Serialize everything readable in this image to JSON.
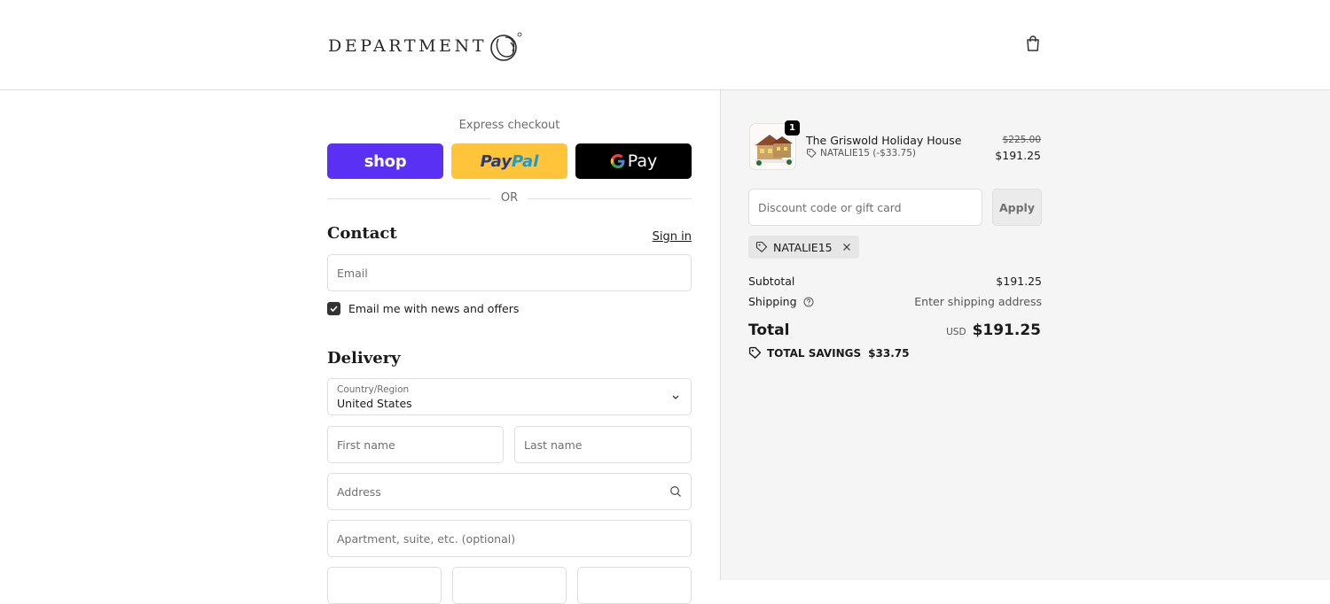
{
  "brand": {
    "name": "DEPARTMENT"
  },
  "express": {
    "title": "Express checkout",
    "shop_label": "shop",
    "paypal_part1": "Pay",
    "paypal_part2": "Pal",
    "gpay_label": "Pay",
    "or_label": "OR"
  },
  "contact": {
    "title": "Contact",
    "signin_label": "Sign in",
    "email_placeholder": "Email",
    "newsletter_label": "Email me with news and offers",
    "newsletter_checked": true
  },
  "delivery": {
    "title": "Delivery",
    "country_label": "Country/Region",
    "country_value": "United States",
    "first_name_placeholder": "First name",
    "last_name_placeholder": "Last name",
    "address_placeholder": "Address",
    "apartment_placeholder": "Apartment, suite, etc. (optional)"
  },
  "order": {
    "item": {
      "quantity": "1",
      "name": "The Griswold Holiday House",
      "discount_line": "NATALIE15 (-$33.75)",
      "price_original": "$225.00",
      "price_final": "$191.25"
    },
    "discount_placeholder": "Discount code or gift card",
    "apply_label": "Apply",
    "applied_code": "NATALIE15",
    "subtotal_label": "Subtotal",
    "subtotal_value": "$191.25",
    "shipping_label": "Shipping",
    "shipping_value": "Enter shipping address",
    "total_label": "Total",
    "total_currency": "USD",
    "total_value": "$191.25",
    "savings_label": "TOTAL SAVINGS",
    "savings_value": "$33.75"
  },
  "colors": {
    "shop": "#5a31f4",
    "paypal": "#ffc439",
    "gpay": "#000000",
    "sidebar_bg": "#f5f5f5"
  }
}
